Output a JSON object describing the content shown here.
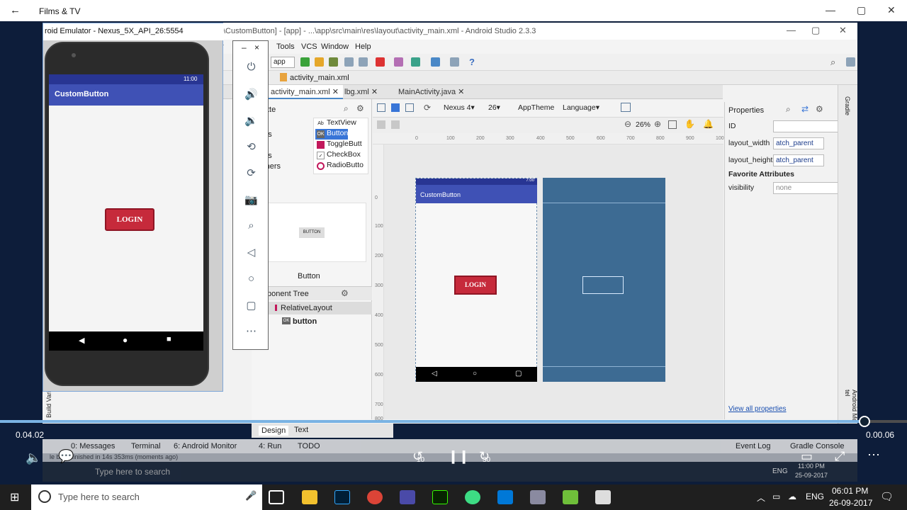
{
  "films_app": {
    "title": "Films & TV",
    "back": "←",
    "minimize": "—",
    "maximize": "▢",
    "close": "✕"
  },
  "studio": {
    "title": "\\CustomButton] - [app] - ...\\app\\src\\main\\res\\layout\\activity_main.xml - Android Studio 2.3.3",
    "menu": [
      "r",
      "Tools",
      "VCS",
      "Window",
      "Help"
    ],
    "run_config": "app",
    "path": "activity_main.xml",
    "tabs": [
      "activity_main.xml",
      "lbg.xml",
      "MainActivity.java"
    ],
    "palette": {
      "header": "tte",
      "cats": [
        "gets",
        "outs",
        "tainers"
      ],
      "items": [
        "TextView",
        "Button",
        "ToggleButt",
        "CheckBox",
        "RadioButto"
      ],
      "selected_label": "Button",
      "preview_btn": "BUTTON"
    },
    "component_tree": {
      "title": "ponent Tree",
      "items": [
        "RelativeLayout",
        "button"
      ]
    },
    "canvas": {
      "device": "Nexus 4▾",
      "api": "26▾",
      "theme": "AppTheme",
      "language": "Language▾",
      "zoom": "26%",
      "ruler_top": [
        "0",
        "100",
        "200",
        "300",
        "400",
        "500",
        "600",
        "700",
        "800",
        "900",
        "100"
      ],
      "ruler_left": [
        "0",
        "100",
        "200",
        "300",
        "400",
        "500",
        "600",
        "700",
        "800"
      ],
      "app_title": "CustomButton",
      "status_time": "7:00",
      "login": "LOGIN"
    },
    "properties": {
      "title": "Properties",
      "id_label": "ID",
      "id_value": "",
      "width_label": "layout_width",
      "width_value": "atch_parent",
      "height_label": "layout_height",
      "height_value": "atch_parent",
      "favorites": "Favorite Attributes",
      "visibility_label": "visibility",
      "visibility_value": "none",
      "view_all": "View all properties"
    },
    "right_strip": {
      "top": "Gradle",
      "bottom": "Android Mo tel"
    },
    "left_strip": "Build Vari",
    "design_tabs": [
      "Design",
      "Text"
    ],
    "bottom_tools": [
      "0: Messages",
      "Terminal",
      "6: Android Monitor",
      "4: Run",
      "TODO",
      "Event Log",
      "Gradle Console"
    ],
    "status": "le build finished in 14s 353ms (moments ago)"
  },
  "emulator": {
    "title": "roid Emulator - Nexus_5X_API_26:5554",
    "status_time": "11:00",
    "app_title": "CustomButton",
    "login": "LOGIN",
    "min": "–",
    "close": "×"
  },
  "player": {
    "elapsed": "0.04.02",
    "remaining": "0.00.06",
    "skip_back": "10",
    "skip_fwd": "30",
    "progress": 0.953
  },
  "taskbar": {
    "search": "Type here to search",
    "lang": "ENG",
    "time": "06:01 PM",
    "date": "26-09-2017",
    "inner_search": "Type here to search",
    "inner_lang": "ENG",
    "inner_time": "11:00 PM",
    "inner_date": "25-09-2017"
  }
}
